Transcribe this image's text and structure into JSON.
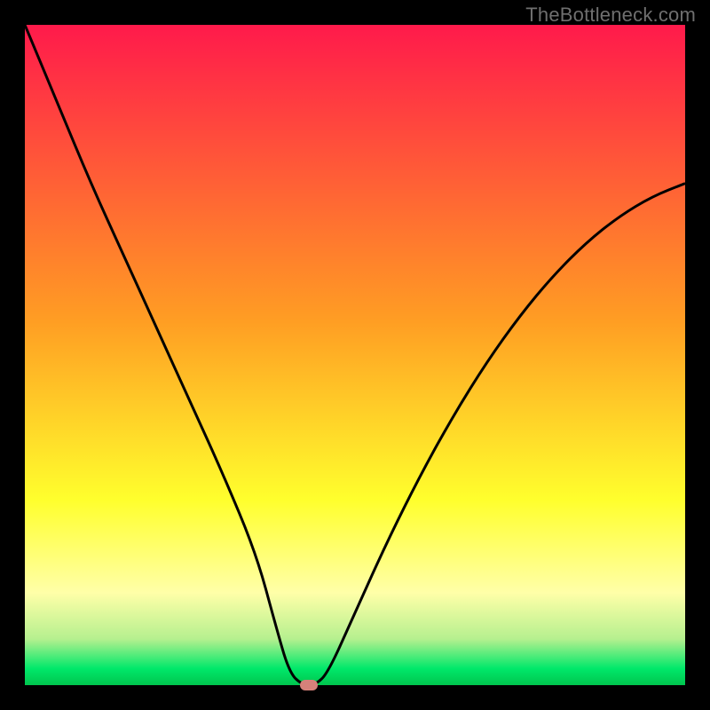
{
  "watermark": "TheBottleneck.com",
  "colors": {
    "black": "#000000",
    "red_top": "#ff1a4b",
    "orange": "#ffa021",
    "yellow": "#ffff2d",
    "pale_yellow": "#ffffa8",
    "light_green": "#9cf08b",
    "green": "#00e05a",
    "curve": "#000000",
    "marker": "#d6817a"
  },
  "chart_data": {
    "type": "line",
    "title": "",
    "xlabel": "",
    "ylabel": "",
    "xlim": [
      0,
      100
    ],
    "ylim": [
      0,
      100
    ],
    "x": [
      0,
      5,
      10,
      15,
      20,
      25,
      30,
      35,
      38,
      40,
      42,
      44,
      46,
      50,
      55,
      60,
      65,
      70,
      75,
      80,
      85,
      90,
      95,
      100
    ],
    "values": [
      100,
      88,
      76,
      65,
      54,
      43,
      32,
      20,
      9,
      2,
      0,
      0,
      2,
      11,
      22,
      32,
      41,
      49,
      56,
      62,
      67,
      71,
      74,
      76
    ],
    "marker": {
      "x": 43,
      "y": 0
    },
    "gradient_stops": [
      {
        "pos": 0.0,
        "color": "#ff1a4b"
      },
      {
        "pos": 0.45,
        "color": "#ff9e23"
      },
      {
        "pos": 0.72,
        "color": "#ffff2d"
      },
      {
        "pos": 0.86,
        "color": "#ffffa8"
      },
      {
        "pos": 0.93,
        "color": "#b6f08f"
      },
      {
        "pos": 0.975,
        "color": "#00e86a"
      },
      {
        "pos": 1.0,
        "color": "#00c54e"
      }
    ]
  }
}
